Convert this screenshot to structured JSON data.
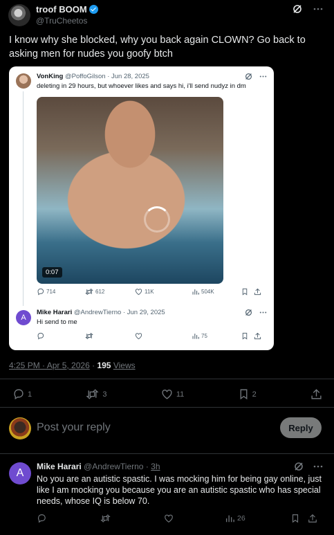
{
  "post": {
    "display_name": "troof BOOM",
    "handle": "@TruCheetos",
    "text": "I know why she blocked, why you back again CLOWN? Go back to asking men for nudes you goofy btch",
    "timestamp": "4:25 PM · Apr 5, 2026",
    "views_count": "195",
    "views_label": "Views",
    "stats": {
      "replies": "1",
      "reposts": "3",
      "likes": "11",
      "bookmarks": "2"
    }
  },
  "quote": {
    "name": "VonKing",
    "meta": "@PoffoGilson · Jun 28, 2025",
    "text": "deleting in 29 hours, but whoever likes and says hi, i'll send nudyz in dm",
    "video_duration": "0:07",
    "stats": {
      "replies": "714",
      "reposts": "612",
      "likes": "11K",
      "views": "504K"
    },
    "reply": {
      "avatar_letter": "A",
      "name": "Mike Harari",
      "meta": "@AndrewTierno · Jun 29, 2025",
      "text": "Hi send to me",
      "views": "75"
    }
  },
  "composer": {
    "placeholder": "Post your reply",
    "button_label": "Reply"
  },
  "comment": {
    "avatar_letter": "A",
    "name": "Mike Harari",
    "handle_prefix": "@AndrewTierno · ",
    "time": "3h",
    "text": "No you are an autistic spastic. I was mocking him for being gay online, just like I am mocking you because you are an autistic spastic who has special needs, whose IQ is below 70.",
    "views": "26"
  },
  "colors": {
    "accent": "#1d9bf0",
    "background": "#000000",
    "muted": "#71767b",
    "divider": "#2f3336"
  }
}
